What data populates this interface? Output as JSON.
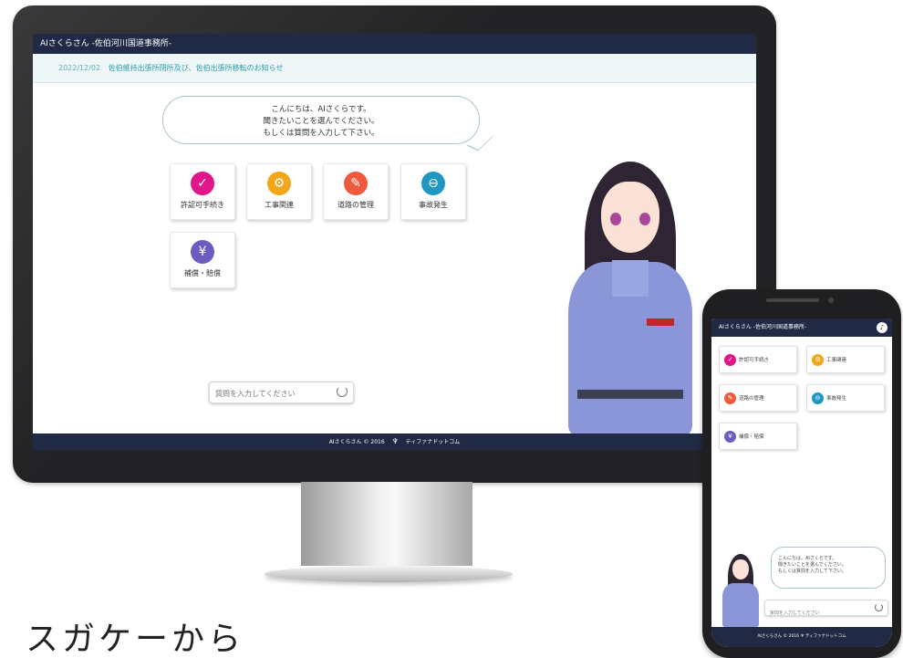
{
  "desktop": {
    "header_title": "AIさくらさん -佐伯河川国道事務所-",
    "notice": {
      "date": "2022/12/02",
      "text": "佐伯維持出張所閉所及び、佐伯出張所移転のお知らせ"
    },
    "greeting": [
      "こんにちは、AIさくらです。",
      "聞きたいことを選んでください。",
      "もしくは質問を入力して下さい。"
    ],
    "tiles": [
      {
        "label": "許認可手続き",
        "color": "#e0168a",
        "glyph": "✓",
        "icon": "check-icon"
      },
      {
        "label": "工事関連",
        "color": "#f2a619",
        "glyph": "⚙",
        "icon": "gears-icon"
      },
      {
        "label": "道路の管理",
        "color": "#ef5a3d",
        "glyph": "✎",
        "icon": "tools-icon"
      },
      {
        "label": "事故発生",
        "color": "#1f97c3",
        "glyph": "⊖",
        "icon": "car-icon"
      },
      {
        "label": "補償・賠償",
        "color": "#6e5bbf",
        "glyph": "¥",
        "icon": "yen-icon"
      }
    ],
    "search_placeholder": "質問を入力してください",
    "footer": {
      "left": "AIさくらさん © 2016",
      "right": "ティファナドットコム"
    }
  },
  "phone": {
    "header_title": "AIさくらさん -佐伯河川国道事務所-",
    "tiles": [
      {
        "label": "許認可手続き",
        "color": "#e0168a",
        "glyph": "✓",
        "icon": "check-icon"
      },
      {
        "label": "工事関連",
        "color": "#f2a619",
        "glyph": "⚙",
        "icon": "gears-icon"
      },
      {
        "label": "道路の管理",
        "color": "#ef5a3d",
        "glyph": "✎",
        "icon": "tools-icon"
      },
      {
        "label": "事故発生",
        "color": "#1f97c3",
        "glyph": "⊖",
        "icon": "car-icon"
      },
      {
        "label": "補償・賠償",
        "color": "#6e5bbf",
        "glyph": "¥",
        "icon": "yen-icon"
      }
    ],
    "greeting": [
      "こんにちは、AIさくらです。",
      "聞きたいことを選んでください。",
      "もしくは質問を入力して下さい。"
    ],
    "search_placeholder": "質問を入力してください",
    "footer": {
      "left": "AIさくらさん © 2016",
      "right": "ティファナドットコム"
    }
  },
  "caption": "スガケーから"
}
